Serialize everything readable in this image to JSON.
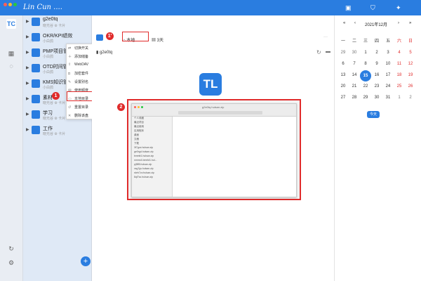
{
  "window": {
    "logo_text": "Lin Cun ....",
    "app_icon": "TC"
  },
  "colors": {
    "accent": "#2a7de0",
    "annotation": "#e02b2b",
    "weekend": "#e02b2b"
  },
  "notebooks": [
    {
      "name": "g2e0tq",
      "sub": "晓光谷 ⚙ 卡片"
    },
    {
      "name": "OKR/KPI绩效",
      "sub": "小白鸽"
    },
    {
      "name": "PMP项目管理",
      "sub": "小白鸽"
    },
    {
      "name": "OTD时间管理",
      "sub": "小白鸽"
    },
    {
      "name": "KMS知识管理",
      "sub": "小白鸽"
    },
    {
      "name": "素材",
      "sub": "晓光谷 ⚙ 卡片"
    },
    {
      "name": "学习",
      "sub": "晓光谷 ⚙ 卡片"
    },
    {
      "name": "工作",
      "sub": "晓光谷 ⚙ 卡片"
    }
  ],
  "context_menu": [
    {
      "label": "切换开关",
      "icon": "switch-icon"
    },
    {
      "label": "添加储备",
      "icon": "add-icon"
    },
    {
      "label": "WebDAV",
      "icon": "webdav-icon"
    },
    {
      "label": "加密套件",
      "icon": "lock-icon"
    },
    {
      "label": "设置别名",
      "icon": "edit-icon"
    },
    {
      "label": "使用频度",
      "icon": "chart-icon"
    },
    {
      "label": "本地目录",
      "icon": "folder-icon"
    },
    {
      "label": "重置目录",
      "icon": "reset-icon"
    },
    {
      "label": "删除该盘",
      "icon": "trash-icon"
    }
  ],
  "main": {
    "breadcrumb_root": "g2e0tq",
    "tab_local": "本地",
    "tab_3day": "3天",
    "folder_name": "g2e0tq",
    "big_logo": "TL"
  },
  "finder": {
    "title": "g2e0tq.hulsan.zip",
    "sidebar": [
      "个人收藏",
      "最近项目",
      "最近使用",
      "应用程序",
      "桌面",
      "文稿",
      "下载"
    ],
    "files": [
      "3f7gux.hulsan.zip",
      "ge0rgd.hulsan.zip",
      "bmekt1.hulsan.zip",
      "nmmx4.bmekt1.hul...",
      "pjf8f5.hulsan.zip",
      "xsg7gv.hulsan.zip",
      "rdeh7zv.hulsan.zip",
      "8qf7sz.hulsan.zip"
    ]
  },
  "annotations": {
    "badge1": "1",
    "badge1p": "1'",
    "badge2": "2"
  },
  "calendar": {
    "month_label": "2021年12月",
    "weekdays": [
      "一",
      "二",
      "三",
      "四",
      "五",
      "六",
      "日"
    ],
    "weeks": [
      [
        "29",
        "30",
        "1",
        "2",
        "3",
        "4",
        "5"
      ],
      [
        "6",
        "7",
        "8",
        "9",
        "10",
        "11",
        "12"
      ],
      [
        "13",
        "14",
        "15",
        "16",
        "17",
        "18",
        "19"
      ],
      [
        "20",
        "21",
        "22",
        "23",
        "24",
        "25",
        "26"
      ],
      [
        "27",
        "28",
        "29",
        "30",
        "31",
        "1",
        "2"
      ]
    ],
    "today": "15",
    "today_button": "今天",
    "prev_year": "«",
    "prev_month": "‹",
    "next_month": "›",
    "next_year": "»"
  }
}
